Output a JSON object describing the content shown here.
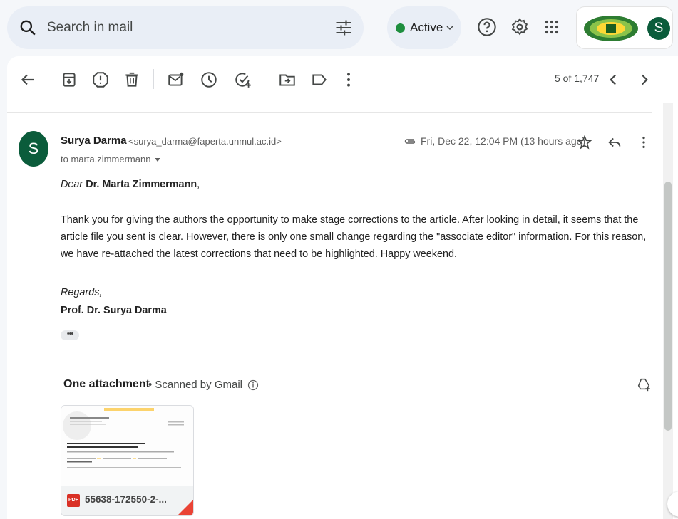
{
  "search": {
    "placeholder": "Search in mail",
    "icon": "search-icon",
    "options_icon": "tune-icon"
  },
  "status": {
    "label": "Active",
    "color": "#1e8e3e"
  },
  "header_icons": [
    "help-icon",
    "settings-icon",
    "apps-icon"
  ],
  "account": {
    "initial": "S",
    "avatar_color": "#0b5c3b"
  },
  "toolbar": {
    "icons": [
      "back-arrow-icon",
      "archive-icon",
      "report-spam-icon",
      "delete-icon",
      "mark-unread-icon",
      "snooze-icon",
      "add-to-tasks-icon",
      "move-to-icon",
      "label-icon",
      "more-vert-icon"
    ],
    "count": "5 of 1,747"
  },
  "message": {
    "sender_initial": "S",
    "sender_name": "Surya Darma",
    "sender_email": "<surya_darma@faperta.unmul.ac.id>",
    "to": "to marta.zimmermann",
    "date": "Fri, Dec 22, 12:04 PM (13 hours ago)",
    "greeting_prefix": "Dear ",
    "greeting_name": "Dr. Marta Zimmermann",
    "greeting_suffix": ",",
    "body": "Thank you for giving the authors the opportunity to make stage corrections to the article. After looking in detail, it seems that the article file you sent is clear. However, there is only one small change regarding the \"associate editor\" information. For this reason, we have re-attached the latest corrections that need to be highlighted. Happy weekend.",
    "closing": "Regards,",
    "signature": "Prof. Dr. Surya Darma",
    "trimmed": "•••"
  },
  "attachments": {
    "title": "One attachment",
    "scanned": "•  Scanned by Gmail",
    "file": {
      "type": "PDF",
      "name": "55638-172550-2-..."
    },
    "thumb": {
      "journal": "Anuario do Instituto de Geociencias",
      "title1": "Towards the New National Capital (IKN) in Indonesia:",
      "title2": "Promises and Challenges of Food Security"
    }
  }
}
